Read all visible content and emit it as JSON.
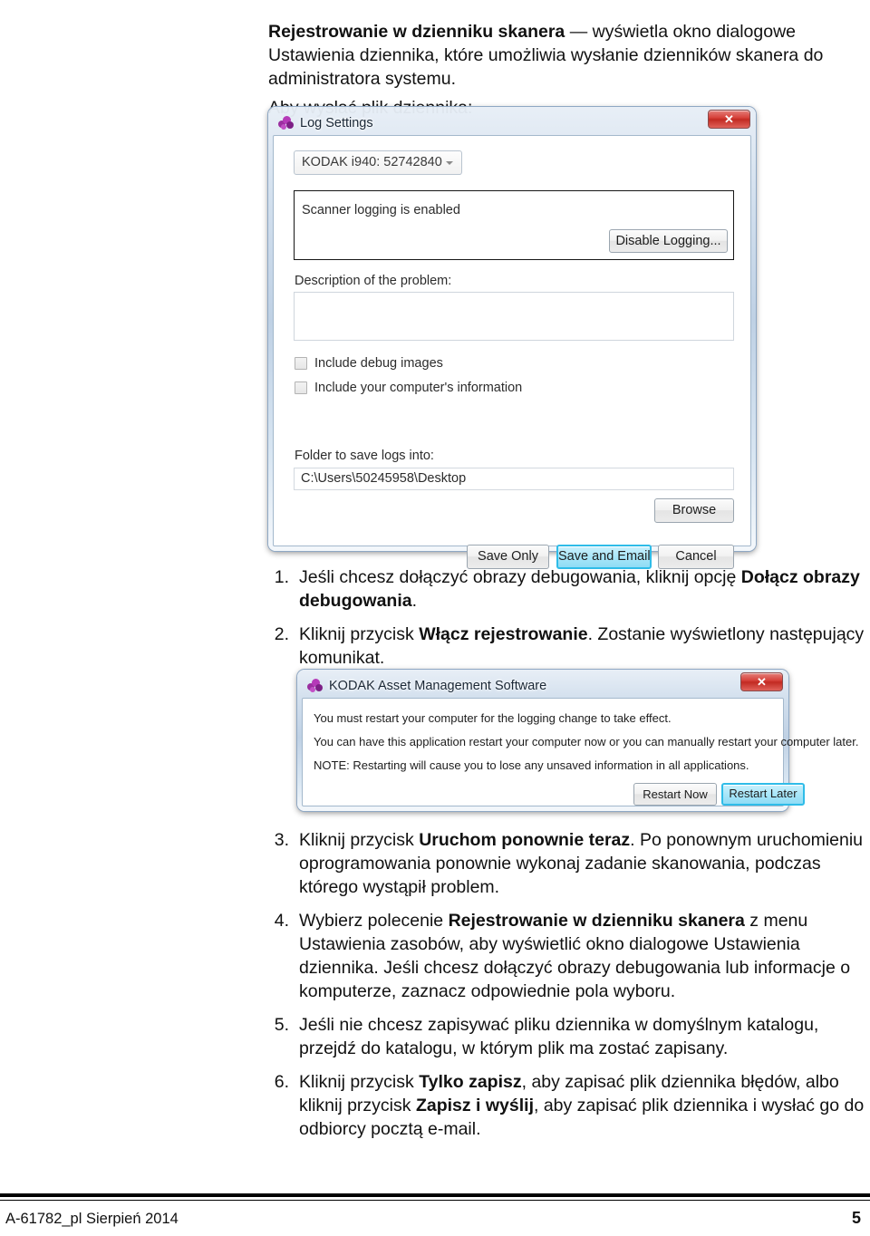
{
  "document": {
    "intro_paragraph": {
      "bold_lead": "Rejestrowanie w dzienniku skanera",
      "rest": " — wyświetla okno dialogowe Ustawienia dziennika, które umożliwia wysłanie dzienników skanera do administratora systemu."
    },
    "lead_in": "Aby wysłać plik dziennika:",
    "steps": [
      {
        "number": "1.",
        "text_before": "Jeśli chcesz dołączyć obrazy debugowania, kliknij opcję ",
        "bold": "Dołącz obrazy debugowania",
        "text_after": "."
      },
      {
        "number": "2.",
        "text_before": "Kliknij przycisk ",
        "bold": "Włącz rejestrowanie",
        "text_after": ". Zostanie wyświetlony następujący komunikat."
      },
      {
        "number": "3.",
        "text_before": "Kliknij przycisk ",
        "bold": "Uruchom ponownie teraz",
        "text_after": ". Po ponownym uruchomieniu oprogramowania ponownie wykonaj zadanie skanowania, podczas którego wystąpił problem."
      },
      {
        "number": "4.",
        "text_before": "Wybierz polecenie ",
        "bold": "Rejestrowanie w dzienniku skanera",
        "text_after": " z menu Ustawienia zasobów, aby wyświetlić okno dialogowe Ustawienia dziennika. Jeśli chcesz dołączyć obrazy debugowania lub informacje o komputerze, zaznacz odpowiednie pola wyboru."
      },
      {
        "number": "5.",
        "text_before": "Jeśli nie chcesz zapisywać pliku dziennika w domyślnym katalogu, przejdź do katalogu, w którym plik ma zostać zapisany.",
        "bold": "",
        "text_after": ""
      },
      {
        "number": "6.",
        "text_before": "Kliknij przycisk ",
        "bold": "Tylko zapisz",
        "text_after": ", aby zapisać plik dziennika błędów, albo kliknij przycisk ",
        "bold2": "Zapisz i wyślij",
        "text_after2": ", aby zapisać plik dziennika i wysłać go do odbiorcy pocztą e-mail."
      }
    ]
  },
  "log_settings_dialog": {
    "title": "Log Settings",
    "icon": "kodak-logo-icon",
    "close_label": "✕",
    "scanner_combo_value": "KODAK i940: 52742840",
    "status_text": "Scanner logging is enabled",
    "disable_logging_label": "Disable Logging...",
    "description_label": "Description of the problem:",
    "description_value": "",
    "checkbox_debug_images": "Include debug images",
    "checkbox_computer_info": "Include your computer's information",
    "folder_label": "Folder to save logs into:",
    "folder_path": "C:\\Users\\50245958\\Desktop",
    "browse_label": "Browse",
    "save_only_label": "Save Only",
    "save_and_email_label": "Save and Email",
    "cancel_label": "Cancel",
    "focus_color": "#2fbce8",
    "close_button_color": "#c22a22"
  },
  "asset_management_dialog": {
    "title": "KODAK Asset Management Software",
    "icon": "kodak-logo-icon",
    "close_label": "✕",
    "line_1": "You must restart your computer for the logging change to take effect.",
    "line_2": "You can have this application restart your computer now or you can manually restart your computer later.",
    "line_3": "NOTE: Restarting will cause you to lose any unsaved information in all applications.",
    "restart_now_label": "Restart Now",
    "restart_later_label": "Restart Later"
  },
  "footer": {
    "left_text": "A-61782_pl  Sierpień 2014",
    "page_number": "5"
  }
}
